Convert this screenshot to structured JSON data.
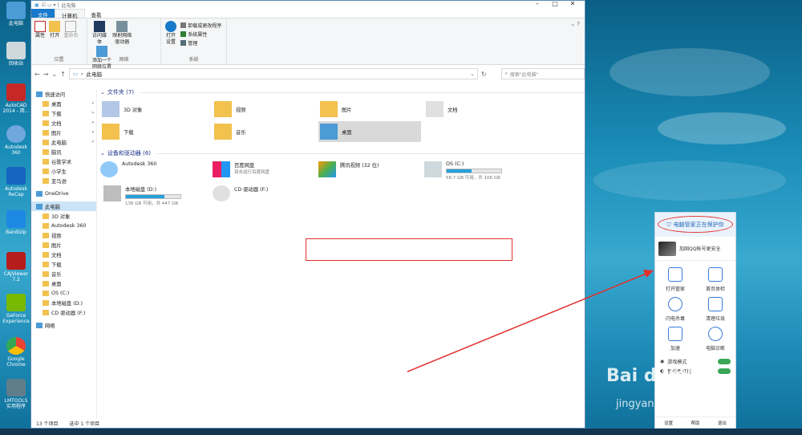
{
  "desktop": {
    "icons": [
      {
        "label": "此电脑",
        "icon": "computer-icon"
      },
      {
        "label": "回收站",
        "icon": "recycle-bin-icon"
      },
      {
        "label": "AutoCAD 2014 - 简...",
        "icon": "autocad-icon"
      },
      {
        "label": "Autodesk 360",
        "icon": "autodesk360-icon"
      },
      {
        "label": "Autodesk ReCap",
        "icon": "recap-icon"
      },
      {
        "label": "Bandizip",
        "icon": "bandizip-icon"
      },
      {
        "label": "CAJViewer 7.2",
        "icon": "cajviewer-icon"
      },
      {
        "label": "GeForce Experience",
        "icon": "geforce-icon"
      },
      {
        "label": "Google Chrome",
        "icon": "chrome-icon"
      },
      {
        "label": "LMTOOLS 实用程序",
        "icon": "lmtools-icon"
      }
    ],
    "watermark": "Bai du经验",
    "watermark_sub": "jingyan.baidu.com"
  },
  "window": {
    "title": "此电脑",
    "tabs": [
      "文件",
      "计算机",
      "查看"
    ],
    "ribbon": {
      "groups": [
        {
          "label": "位置",
          "buttons": [
            "属性",
            "打开",
            "重命名"
          ]
        },
        {
          "label": "网络",
          "buttons": [
            "访问媒体",
            "映射网络驱动器",
            "添加一个网络位置"
          ]
        },
        {
          "label": "系统",
          "big": "打开设置",
          "small": [
            "卸载或更改程序",
            "系统属性",
            "管理"
          ]
        }
      ]
    },
    "address": {
      "path": "此电脑",
      "search_placeholder": "搜索\"此电脑\""
    },
    "nav": [
      {
        "label": "快速访问",
        "level": 0
      },
      {
        "label": "桌面",
        "level": 1,
        "pin": true
      },
      {
        "label": "下载",
        "level": 1,
        "pin": true
      },
      {
        "label": "文档",
        "level": 1,
        "pin": true
      },
      {
        "label": "图片",
        "level": 1,
        "pin": true
      },
      {
        "label": "此电脑",
        "level": 1,
        "pin": true
      },
      {
        "label": "脑讯",
        "level": 1
      },
      {
        "label": "谷歌学术",
        "level": 1
      },
      {
        "label": "小学生",
        "level": 1
      },
      {
        "label": "亚马逊",
        "level": 1
      },
      {
        "label": "OneDrive",
        "level": 0
      },
      {
        "label": "此电脑",
        "level": 0,
        "selected": true
      },
      {
        "label": "3D 对象",
        "level": 1
      },
      {
        "label": "Autodesk 360",
        "level": 1
      },
      {
        "label": "视频",
        "level": 1
      },
      {
        "label": "图片",
        "level": 1
      },
      {
        "label": "文档",
        "level": 1
      },
      {
        "label": "下载",
        "level": 1
      },
      {
        "label": "音乐",
        "level": 1
      },
      {
        "label": "桌面",
        "level": 1
      },
      {
        "label": "OS (C:)",
        "level": 1
      },
      {
        "label": "本地磁盘 (D:)",
        "level": 1
      },
      {
        "label": "CD 驱动器 (F:)",
        "level": 1
      },
      {
        "label": "网络",
        "level": 0
      }
    ],
    "folders_header": "文件夹 (7)",
    "folders": [
      "3D 对象",
      "视频",
      "图片",
      "文档",
      "下载",
      "音乐",
      "桌面"
    ],
    "drives_header": "设备和驱动器 (6)",
    "drives": [
      {
        "name": "Autodesk 360",
        "sub": ""
      },
      {
        "name": "百度网盘",
        "sub": "双击运行百度网盘"
      },
      {
        "name": "腾讯视频 (32 位)",
        "sub": ""
      },
      {
        "name": "OS (C:)",
        "sub": "58.7 GB 可用，共 106 GB",
        "used": 0.45
      },
      {
        "name": "本地磁盘 (D:)",
        "sub": "136 GB 可用，共 447 GB",
        "used": 0.7
      },
      {
        "name": "CD 驱动器 (F:)",
        "sub": ""
      }
    ],
    "status": {
      "count": "13 个项目",
      "selected": "选中 1 个项目"
    }
  },
  "popup": {
    "title": "电脑管家正在保护你",
    "user_text": "加固QQ帐号更安全",
    "items": [
      "打开管家",
      "首页体检",
      "闪电杀毒",
      "清理垃圾",
      "加速",
      "电脑诊断"
    ],
    "toggles": [
      "游戏模式",
      "智能免打扰"
    ],
    "footer": [
      "设置",
      "帮助",
      "退出"
    ]
  },
  "colors": {
    "accent": "#1979ca",
    "annotation": "#e2302d"
  }
}
